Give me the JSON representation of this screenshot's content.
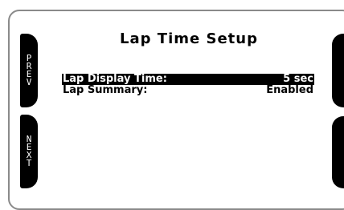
{
  "screen": {
    "title": "Lap Time Setup"
  },
  "softkeys": {
    "prev_label": "PREV",
    "next_label": "NEXT"
  },
  "menu": {
    "items": [
      {
        "label": "Lap Display Time:",
        "value": "5 sec",
        "selected": true
      },
      {
        "label": "Lap Summary:",
        "value": "Enabled",
        "selected": false
      }
    ]
  }
}
